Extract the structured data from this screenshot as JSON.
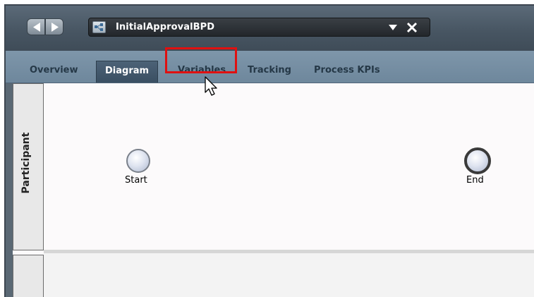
{
  "window": {
    "document_title": "InitialApprovalBPD",
    "back_icon": "arrow-left-icon",
    "forward_icon": "arrow-right-icon",
    "document_icon": "bpd-icon",
    "dropdown_icon": "dropdown-triangle-icon",
    "close_icon": "close-icon"
  },
  "tabs": [
    {
      "label": "Overview",
      "selected": false
    },
    {
      "label": "Diagram",
      "selected": true
    },
    {
      "label": "Variables",
      "selected": false,
      "highlighted": true
    },
    {
      "label": "Tracking",
      "selected": false
    },
    {
      "label": "Process KPIs",
      "selected": false
    }
  ],
  "diagram": {
    "lane_label": "Participant",
    "start_label": "Start",
    "end_label": "End"
  },
  "colors": {
    "highlight": "#e01010",
    "titlebar": "#4a5866",
    "tabbar": "#7690a5",
    "selected_tab": "#42586c"
  }
}
